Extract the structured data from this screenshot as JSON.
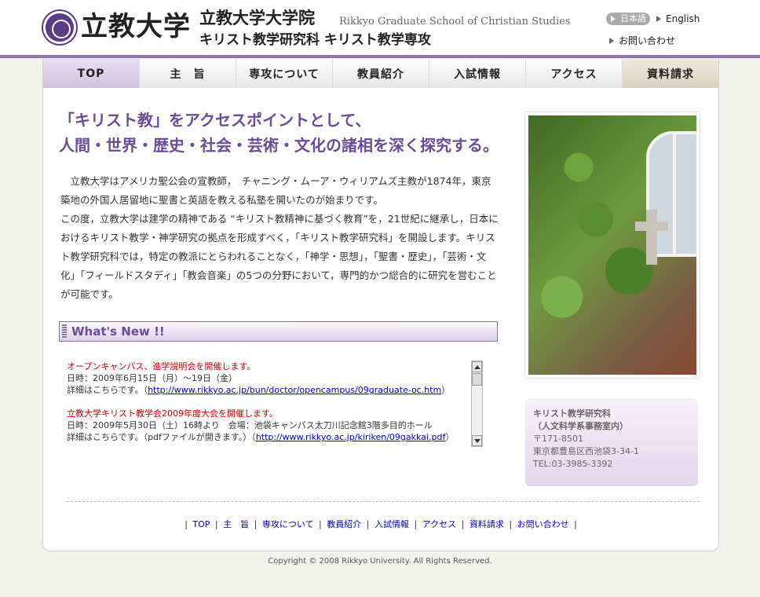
{
  "header": {
    "university_name": "立教大学",
    "grad_school_jp": "立教大学大学院",
    "grad_school_en": "Rikkyo Graduate School of Christian Studies",
    "department": "キリスト教学研究科 キリスト教学専攻",
    "lang_japanese": "日本語",
    "lang_english": "English",
    "contact": "お問い合わせ"
  },
  "nav": [
    {
      "label": "TOP"
    },
    {
      "label": "主　旨"
    },
    {
      "label": "専攻について"
    },
    {
      "label": "教員紹介"
    },
    {
      "label": "入試情報"
    },
    {
      "label": "アクセス"
    },
    {
      "label": "資料請求"
    }
  ],
  "main": {
    "headline_line1": "「キリスト教」をアクセスポイントとして、",
    "headline_line2": "人間・世界・歴史・社会・芸術・文化の諸相を深く探究する。",
    "intro_p1": "　立教大学はアメリカ聖公会の宣教師，　チャニング・ムーア・ウィリアムズ主教が1874年，東京築地の外国人居留地に聖書と英語を教える私塾を開いたのが始まりです。",
    "intro_p2": "この度，立教大学は建学の精神である “キリスト教精神に基づく教育”を，21世紀に継承し，日本におけるキリスト教学・神学研究の拠点を形成すべく，「キリスト教学研究科」を開設します。キリスト教学研究科では，特定の教派にとらわれることなく，「神学・思想」，「聖書・歴史」，「芸術・文化」「フィールドスタディ」「教会音楽」の5つの分野において，専門的かつ総合的に研究を営むことが可能です。"
  },
  "whats_new": {
    "title": "What's New !!",
    "items": [
      {
        "title": "オープンキャンパス、進学説明会を開催します。",
        "date": "日時：2009年6月15日（月）～19日（金）",
        "detail_prefix": "詳細はこちらです。（",
        "link": "http://www.rikkyo.ac.jp/bun/doctor/opencampus/09graduate-oc.htm",
        "detail_suffix": "）"
      },
      {
        "title": "立教大学キリスト教学会2009年度大会を開催します。",
        "date": "日時：2009年5月30日（土）16時より　会場：池袋キャンパス太刀川記念館3階多目的ホール",
        "detail_prefix": "詳細はこちらです。（pdfファイルが開きます。）（",
        "link": "http://www.rikkyo.ac.jp/kiriken/09gakkai.pdf",
        "detail_suffix": "）"
      }
    ]
  },
  "info_box": {
    "line1": "キリスト教学研究科",
    "line2": "（人文科学系事務室内）",
    "postal": "〒171-8501",
    "address": "東京都豊島区西池袋3-34-1",
    "tel": "TEL:03-3985-3392"
  },
  "footer_nav": [
    "TOP",
    "主　旨",
    "専攻について",
    "教員紹介",
    "入試情報",
    "アクセス",
    "資料請求",
    "お問い合わせ"
  ],
  "copyright": "Copyright © 2008 Rikkyo University. All Rights Reserved.",
  "colors": {
    "accent_purple": "#6a4c97",
    "header_line": "#8b74ad",
    "news_title_red": "#cc0000",
    "link_blue": "#0000cc"
  }
}
